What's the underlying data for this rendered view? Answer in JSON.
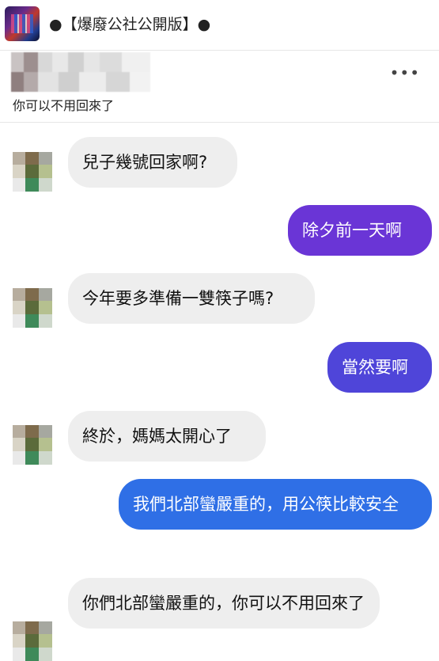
{
  "header": {
    "group_title": "●【爆廢公社公開版】●"
  },
  "post": {
    "more_icon": "•••",
    "preview_text": "你可以不用回來了"
  },
  "messages": [
    {
      "side": "incoming",
      "text": "兒子幾號回家啊?"
    },
    {
      "side": "outgoing",
      "text": "除夕前一天啊",
      "color": "#6a35d6"
    },
    {
      "side": "incoming",
      "text": "今年要多準備一雙筷子嗎?"
    },
    {
      "side": "outgoing",
      "text": "當然要啊",
      "color": "#4f45d9"
    },
    {
      "side": "incoming",
      "text": "終於，媽媽太開心了"
    },
    {
      "side": "outgoing",
      "text": "我們北部蠻嚴重的，用公筷比較安全",
      "color": "#2f6fe6"
    },
    {
      "side": "incoming",
      "text": "你們北部蠻嚴重的，你可以不用回來了"
    }
  ]
}
